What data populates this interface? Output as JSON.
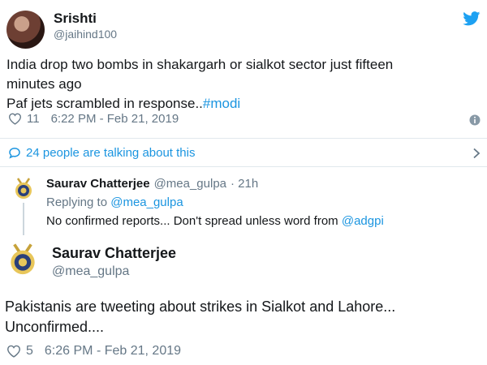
{
  "tweet1": {
    "display_name": "Srishti",
    "handle": "@jaihind100",
    "text_line1": "India drop two bombs in shakargarh or sialkot  sector just fifteen",
    "text_line2": "minutes ago",
    "text_line3_pre": "Paf jets scrambled in response..",
    "hashtag": "#modi",
    "like_count": "11",
    "timestamp": "6:22 PM - Feb 21, 2019",
    "brand_icon": "twitter-bird-icon",
    "info_icon": "info-icon"
  },
  "conversation": {
    "label": "24 people are talking about this"
  },
  "reply": {
    "display_name": "Saurav Chatterjee",
    "handle": "@mea_gulpa",
    "age": "· 21h",
    "replying_to_pre": "Replying to",
    "replying_to_handle": "@mea_gulpa",
    "text_pre": "No confirmed reports...  Don't spread unless word from",
    "mention": "@adgpi"
  },
  "tweet2": {
    "display_name": "Saurav Chatterjee",
    "handle": "@mea_gulpa",
    "text_line1": "Pakistanis are tweeting about strikes in Sialkot and Lahore...",
    "text_line2": "Unconfirmed....",
    "like_count": "5",
    "timestamp": "6:26 PM - Feb 21, 2019"
  },
  "colors": {
    "accent": "#1b95e0",
    "muted": "#657786",
    "divider": "#e1e8ed"
  }
}
